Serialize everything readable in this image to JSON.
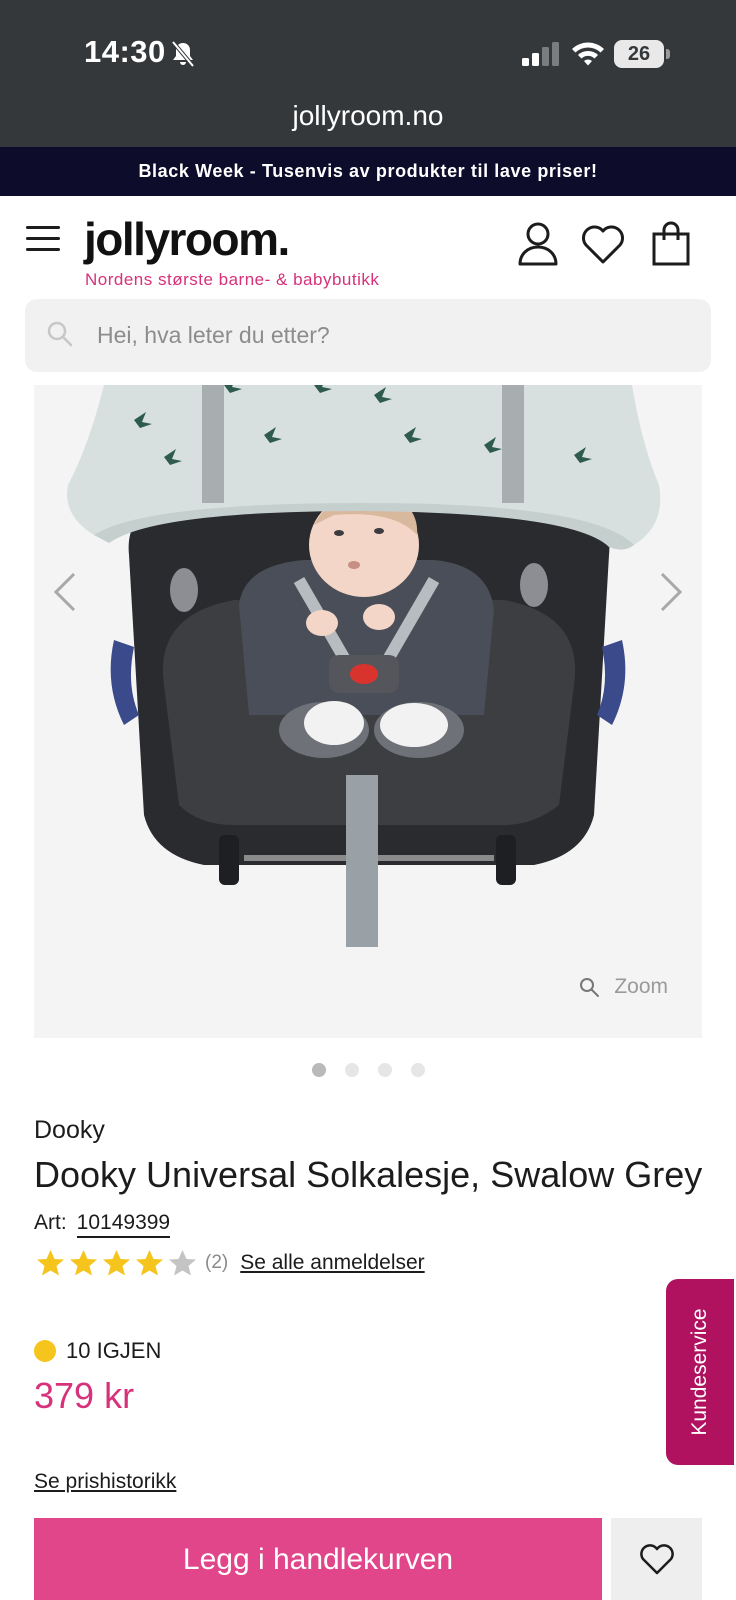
{
  "status_bar": {
    "time": "14:30",
    "battery": "26"
  },
  "browser": {
    "url": "jollyroom.no"
  },
  "promo_banner": {
    "text": "Black Week - Tusenvis av produkter til lave priser!"
  },
  "header": {
    "logo": "jollyroom.",
    "tagline": "Nordens største barne- & babybutikk",
    "icons": [
      "menu-icon",
      "account-icon",
      "wishlist-icon",
      "cart-icon"
    ]
  },
  "search": {
    "placeholder": "Hei, hva leter du etter?"
  },
  "gallery": {
    "zoom_label": "Zoom",
    "image_count": 4,
    "active_index": 0
  },
  "product": {
    "brand": "Dooky",
    "title": "Dooky Universal Solkalesje, Swalow Grey",
    "art_label": "Art:",
    "art_number": "10149399",
    "rating": 4,
    "rating_max": 5,
    "review_count": "(2)",
    "reviews_link": "Se alle anmeldelser",
    "stock_text": "10 IGJEN",
    "price": "379 kr",
    "price_history_link": "Se prishistorikk",
    "add_to_cart_label": "Legg i handlekurven"
  },
  "support": {
    "label": "Kundeservice"
  },
  "colors": {
    "brand_pink": "#e2468a",
    "price_pink": "#d6317a",
    "support_magenta": "#b0125f",
    "promo_navy": "#0d0c2b",
    "stock_yellow": "#f5c51e",
    "star_yellow": "#f5c51e"
  }
}
